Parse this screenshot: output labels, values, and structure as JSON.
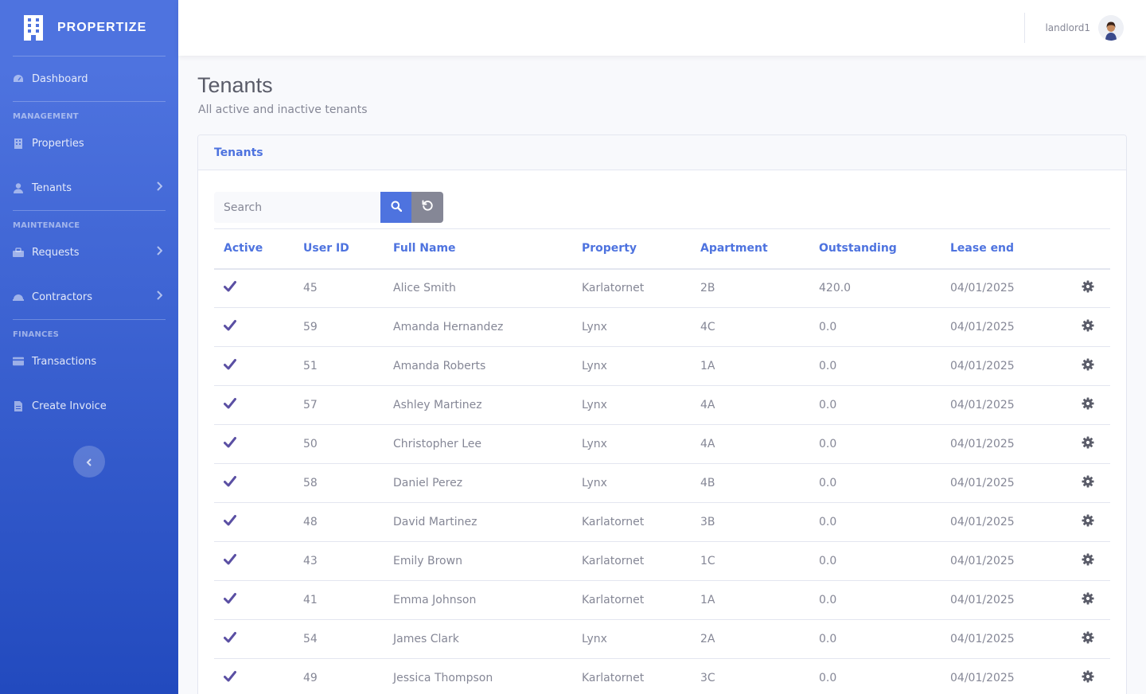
{
  "brand": {
    "name": "PROPERTIZE"
  },
  "sidebar": {
    "dashboard": "Dashboard",
    "sections": {
      "management": "MANAGEMENT",
      "maintenance": "MAINTENANCE",
      "finances": "FINANCES"
    },
    "items": {
      "properties": "Properties",
      "tenants": "Tenants",
      "requests": "Requests",
      "contractors": "Contractors",
      "transactions": "Transactions",
      "create_invoice": "Create Invoice"
    }
  },
  "topbar": {
    "username": "landlord1"
  },
  "page": {
    "title": "Tenants",
    "subtitle": "All active and inactive tenants"
  },
  "card": {
    "title": "Tenants"
  },
  "search": {
    "placeholder": "Search"
  },
  "table": {
    "headers": [
      "Active",
      "User ID",
      "Full Name",
      "Property",
      "Apartment",
      "Outstanding",
      "Lease end"
    ],
    "rows": [
      {
        "user_id": "45",
        "name": "Alice Smith",
        "property": "Karlatornet",
        "apartment": "2B",
        "outstanding": "420.0",
        "lease_end": "04/01/2025"
      },
      {
        "user_id": "59",
        "name": "Amanda Hernandez",
        "property": "Lynx",
        "apartment": "4C",
        "outstanding": "0.0",
        "lease_end": "04/01/2025"
      },
      {
        "user_id": "51",
        "name": "Amanda Roberts",
        "property": "Lynx",
        "apartment": "1A",
        "outstanding": "0.0",
        "lease_end": "04/01/2025"
      },
      {
        "user_id": "57",
        "name": "Ashley Martinez",
        "property": "Lynx",
        "apartment": "4A",
        "outstanding": "0.0",
        "lease_end": "04/01/2025"
      },
      {
        "user_id": "50",
        "name": "Christopher Lee",
        "property": "Lynx",
        "apartment": "4A",
        "outstanding": "0.0",
        "lease_end": "04/01/2025"
      },
      {
        "user_id": "58",
        "name": "Daniel Perez",
        "property": "Lynx",
        "apartment": "4B",
        "outstanding": "0.0",
        "lease_end": "04/01/2025"
      },
      {
        "user_id": "48",
        "name": "David Martinez",
        "property": "Karlatornet",
        "apartment": "3B",
        "outstanding": "0.0",
        "lease_end": "04/01/2025"
      },
      {
        "user_id": "43",
        "name": "Emily Brown",
        "property": "Karlatornet",
        "apartment": "1C",
        "outstanding": "0.0",
        "lease_end": "04/01/2025"
      },
      {
        "user_id": "41",
        "name": "Emma Johnson",
        "property": "Karlatornet",
        "apartment": "1A",
        "outstanding": "0.0",
        "lease_end": "04/01/2025"
      },
      {
        "user_id": "54",
        "name": "James Clark",
        "property": "Lynx",
        "apartment": "2A",
        "outstanding": "0.0",
        "lease_end": "04/01/2025"
      },
      {
        "user_id": "49",
        "name": "Jessica Thompson",
        "property": "Karlatornet",
        "apartment": "3C",
        "outstanding": "0.0",
        "lease_end": "04/01/2025"
      }
    ]
  },
  "colors": {
    "primary": "#4e73df",
    "secondary": "#858796",
    "check": "#5a4fa3"
  },
  "icons": {
    "active": "check-icon",
    "row_action": "gear-icon"
  }
}
